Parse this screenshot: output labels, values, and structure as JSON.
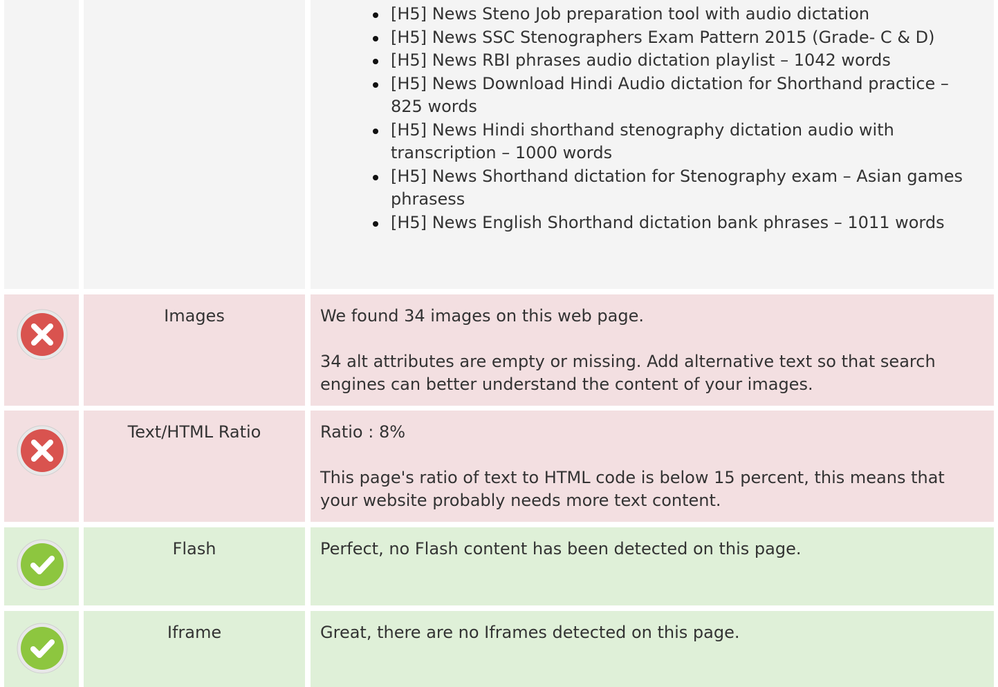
{
  "headings": [
    {
      "tag": "[H5]",
      "text": "News Steno Job preparation tool with audio dictation"
    },
    {
      "tag": "[H5]",
      "text": "News SSC Stenographers Exam Pattern 2015 (Grade- C & D)"
    },
    {
      "tag": "[H5]",
      "text": "News RBI phrases audio dictation playlist – 1042 words"
    },
    {
      "tag": "[H5]",
      "text": "News Download Hindi Audio dictation for Shorthand practice – 825 words"
    },
    {
      "tag": "[H5]",
      "text": "News Hindi shorthand stenography dictation audio with transcription – 1000 words"
    },
    {
      "tag": "[H5]",
      "text": "News Shorthand dictation for Stenography exam – Asian games phrasess"
    },
    {
      "tag": "[H5]",
      "text": "News English Shorthand dictation bank phrases – 1011 words"
    }
  ],
  "checks": [
    {
      "status": "error",
      "icon": "error-x-icon",
      "name": "Images",
      "summary": "We found 34 images on this web page.",
      "detail": "34 alt attributes are empty or missing. Add alternative text so that search engines can better understand the content of your images."
    },
    {
      "status": "error",
      "icon": "error-x-icon",
      "name": "Text/HTML Ratio",
      "summary": "Ratio : 8%",
      "detail": "This page's ratio of text to HTML code is below 15 percent, this means that your website probably needs more text content."
    },
    {
      "status": "pass",
      "icon": "check-mark-icon",
      "name": "Flash",
      "summary": "Perfect, no Flash content has been detected on this page."
    },
    {
      "status": "pass",
      "icon": "check-mark-icon",
      "name": "Iframe",
      "summary": "Great, there are no Iframes detected on this page."
    }
  ],
  "colors": {
    "error_bg": "#f3dfe1",
    "pass_bg": "#dff0d8",
    "neutral_bg": "#f4f4f4",
    "error_icon": "#d9534f",
    "pass_icon": "#8dc63f"
  }
}
